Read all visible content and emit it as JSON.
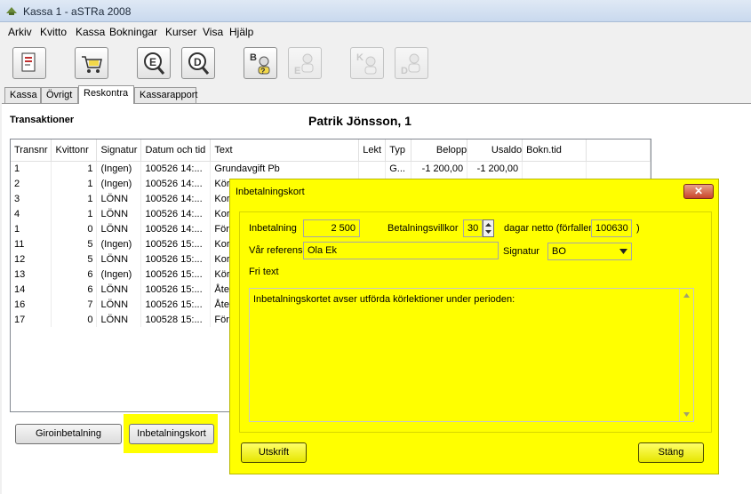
{
  "window": {
    "title": "Kassa 1 - aSTRa 2008"
  },
  "menu": [
    "Arkiv",
    "Kvitto",
    "Kassa",
    "Bokningar",
    "Kurser",
    "Visa",
    "Hjälp"
  ],
  "toolbar": {
    "icons": [
      "receipt-icon",
      "cart-icon",
      "customer-e-icon",
      "customer-d-icon",
      "booking-b-icon",
      "booking-e-icon",
      "booking-k-icon",
      "booking-d-icon"
    ]
  },
  "tabs": [
    "Kassa",
    "Övrigt",
    "Reskontra",
    "Kassarapport"
  ],
  "main": {
    "section_title": "Transaktioner",
    "customer_name": "Patrik Jönsson, 1",
    "columns": [
      "Transnr",
      "Kvittonr",
      "Signatur",
      "Datum och tid",
      "Text",
      "Lekt",
      "Typ",
      "Belopp",
      "Usaldo",
      "Bokn.tid"
    ],
    "rows": [
      [
        "1",
        "1",
        "(Ingen)",
        "100526 14:...",
        "Grundavgift Pb",
        "",
        "G...",
        "-1 200,00",
        "-1 200,00",
        ""
      ],
      [
        "2",
        "1",
        "(Ingen)",
        "100526 14:...",
        "Körl",
        "",
        "",
        "",
        "",
        ""
      ],
      [
        "3",
        "1",
        "LÖNN",
        "100526 14:...",
        "Kor",
        "",
        "",
        "",
        "",
        ""
      ],
      [
        "4",
        "1",
        "LÖNN",
        "100526 14:...",
        "Kor",
        "",
        "",
        "",
        "",
        ""
      ],
      [
        "1",
        "0",
        "LÖNN",
        "100526 14:...",
        "Förs",
        "",
        "",
        "",
        "",
        ""
      ],
      [
        "11",
        "5",
        "(Ingen)",
        "100526 15:...",
        "Kor",
        "",
        "",
        "",
        "",
        ""
      ],
      [
        "12",
        "5",
        "LÖNN",
        "100526 15:...",
        "Kor",
        "",
        "",
        "",
        "",
        ""
      ],
      [
        "13",
        "6",
        "(Ingen)",
        "100526 15:...",
        "Körl",
        "",
        "",
        "",
        "",
        ""
      ],
      [
        "14",
        "6",
        "LÖNN",
        "100526 15:...",
        "Åter",
        "",
        "",
        "",
        "",
        ""
      ],
      [
        "16",
        "7",
        "LÖNN",
        "100526 15:...",
        "Åter",
        "",
        "",
        "",
        "",
        ""
      ],
      [
        "17",
        "0",
        "LÖNN",
        "100528 15:...",
        "Förs",
        "",
        "",
        "",
        "",
        ""
      ]
    ],
    "giro_button": "Giroinbetalning",
    "inbet_button": "Inbetalningskort"
  },
  "dialog": {
    "title": "Inbetalningskort",
    "close": "✕",
    "amount_label": "Inbetalning",
    "amount_value": "2 500",
    "terms_label": "Betalningsvillkor",
    "terms_value": "30",
    "days_label": "dagar netto (förfaller",
    "due_value": "100630",
    "paren_close": ")",
    "ref_label": "Vår referens",
    "ref_value": "Ola Ek",
    "sig_label": "Signatur",
    "sig_value": "BO",
    "free_text_label": "Fri text",
    "free_text_value": "Inbetalningskortet avser utförda körlektioner under perioden:",
    "print_button": "Utskrift",
    "close_button": "Stäng"
  },
  "colors": {
    "highlight": "#ffff00",
    "title_close": "#c9452a"
  }
}
